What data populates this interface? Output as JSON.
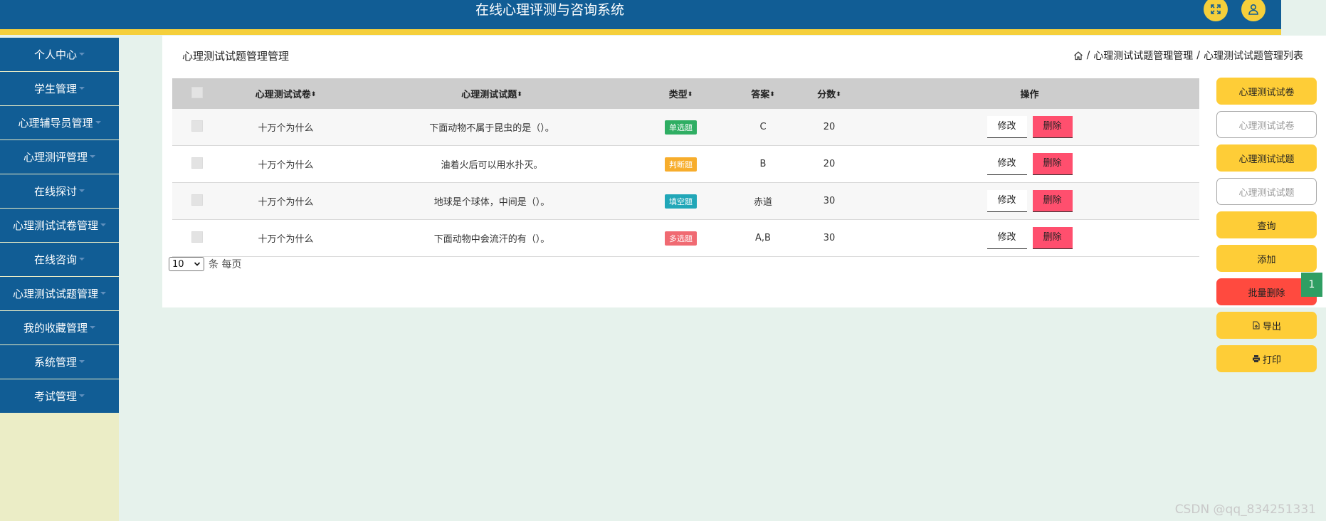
{
  "header": {
    "title": "在线心理评测与咨询系统"
  },
  "sidebar": {
    "items": [
      {
        "label": "个人中心"
      },
      {
        "label": "学生管理"
      },
      {
        "label": "心理辅导员管理"
      },
      {
        "label": "心理测评管理"
      },
      {
        "label": "在线探讨"
      },
      {
        "label": "心理测试试卷管理"
      },
      {
        "label": "在线咨询"
      },
      {
        "label": "心理测试试题管理"
      },
      {
        "label": "我的收藏管理"
      },
      {
        "label": "系统管理"
      },
      {
        "label": "考试管理"
      }
    ]
  },
  "page": {
    "title": "心理测试试题管理管理",
    "breadcrumb": {
      "sep1": "/",
      "crumb1": "心理测试试题管理管理",
      "sep2": "/",
      "crumb2": "心理测试试题管理列表"
    }
  },
  "table": {
    "headers": {
      "paper": "心理测试试卷",
      "question": "心理测试试题",
      "type": "类型",
      "answer": "答案",
      "score": "分数",
      "ops": "操作",
      "sort_glyph": "⬍"
    },
    "rows": [
      {
        "paper": "十万个为什么",
        "question": "下面动物不属于昆虫的是（）。",
        "type": "单选题",
        "type_color": "#2fae63",
        "answer": "C",
        "score": "20",
        "edit": "修改",
        "delete": "删除"
      },
      {
        "paper": "十万个为什么",
        "question": "油着火后可以用水扑灭。",
        "type": "判断题",
        "type_color": "#f7ad2c",
        "answer": "B",
        "score": "20",
        "edit": "修改",
        "delete": "删除"
      },
      {
        "paper": "十万个为什么",
        "question": "地球是个球体，中间是（）。",
        "type": "填空题",
        "type_color": "#21a7b8",
        "answer": "赤道",
        "score": "30",
        "edit": "修改",
        "delete": "删除"
      },
      {
        "paper": "十万个为什么",
        "question": "下面动物中会流汗的有（）。",
        "type": "多选题",
        "type_color": "#f06a72",
        "answer": "A,B",
        "score": "30",
        "edit": "修改",
        "delete": "删除"
      }
    ]
  },
  "pager": {
    "page_size": "10",
    "suffix": "条 每页"
  },
  "actions": {
    "btn_paper": "心理测试试卷",
    "input_paper_placeholder": "心理测试试卷",
    "btn_question": "心理测试试题",
    "input_question_placeholder": "心理测试试题",
    "query": "查询",
    "add": "添加",
    "batch_delete": "批量删除",
    "export": "导出",
    "print": "打印"
  },
  "badge": {
    "value": "1"
  },
  "watermark": "CSDN @qq_834251331"
}
